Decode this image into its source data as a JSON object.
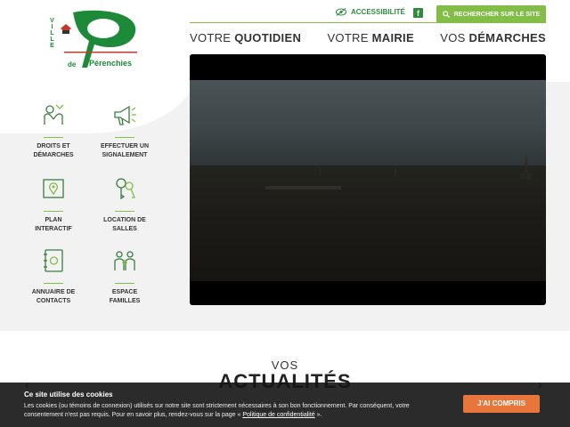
{
  "logo": {
    "ville": "VILLE",
    "de": "de",
    "name": "Pérenchies"
  },
  "topbar": {
    "accessibility": "ACCESSIBILITÉ",
    "facebook_icon": "facebook-icon",
    "search_label": "RECHERCHER SUR LE SITE"
  },
  "nav": [
    {
      "prefix": "VOTRE ",
      "bold": "QUOTIDIEN"
    },
    {
      "prefix": "VOTRE ",
      "bold": "MAIRIE"
    },
    {
      "prefix": "VOS ",
      "bold": "DÉMARCHES"
    }
  ],
  "quicklinks": [
    {
      "label1": "DROITS ET",
      "label2": "DÉMARCHES",
      "icon": "hands-icon"
    },
    {
      "label1": "EFFECTUER UN",
      "label2": "SIGNALEMENT",
      "icon": "megaphone-icon"
    },
    {
      "label1": "PLAN",
      "label2": "INTERACTIF",
      "icon": "map-pin-icon"
    },
    {
      "label1": "LOCATION DE",
      "label2": "SALLES",
      "icon": "keys-icon"
    },
    {
      "label1": "ANNUAIRE DE",
      "label2": "CONTACTS",
      "icon": "address-book-icon"
    },
    {
      "label1": "ESPACE",
      "label2": "FAMILLES",
      "icon": "family-icon"
    }
  ],
  "news": {
    "vos": "VOS",
    "title": "ACTUALITÉS",
    "prev": "‹",
    "next": "›"
  },
  "cookie": {
    "title": "Ce site utilise des cookies",
    "text": "Les cookies (ou témoins de connexion) utilisés sur notre site sont strictement nécessaires à son bon fonctionnement. Par conséquent, votre consentement n'est pas requis. Pour en savoir plus, rendez-vous sur la page «",
    "link": "Politique de confidentialité",
    "text_end": "».",
    "accept": "J'AI COMPRIS"
  },
  "colors": {
    "brand_green": "#1d8a3a",
    "accent_green": "#82bd47",
    "cookie_button": "#e8763a"
  }
}
